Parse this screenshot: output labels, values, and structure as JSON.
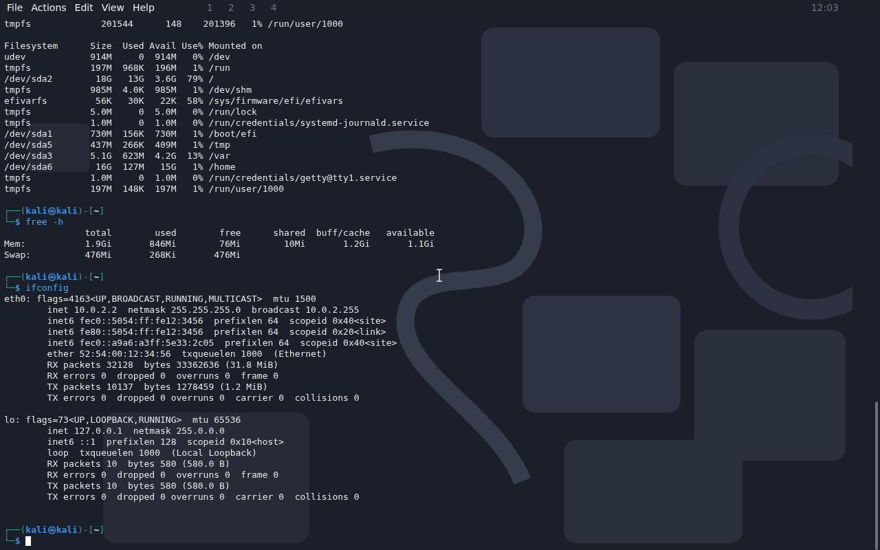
{
  "menu": [
    "File",
    "Actions",
    "Edit",
    "View",
    "Help"
  ],
  "panel": {
    "workspaces": [
      "1",
      "2",
      "3",
      "4"
    ],
    "clock": "12:03"
  },
  "lines": [
    {
      "kind": "output",
      "text": "tmpfs             201544      148    201396   1% /run/user/1000"
    },
    {
      "kind": "blank"
    },
    {
      "kind": "output",
      "text": "Filesystem      Size  Used Avail Use% Mounted on"
    },
    {
      "kind": "output",
      "text": "udev            914M     0  914M   0% /dev"
    },
    {
      "kind": "output",
      "text": "tmpfs           197M  968K  196M   1% /run"
    },
    {
      "kind": "output",
      "text": "/dev/sda2        18G   13G  3.6G  79% /"
    },
    {
      "kind": "output",
      "text": "tmpfs           985M  4.0K  985M   1% /dev/shm"
    },
    {
      "kind": "output",
      "text": "efivarfs         56K   30K   22K  58% /sys/firmware/efi/efivars"
    },
    {
      "kind": "output",
      "text": "tmpfs           5.0M     0  5.0M   0% /run/lock"
    },
    {
      "kind": "output",
      "text": "tmpfs           1.0M     0  1.0M   0% /run/credentials/systemd-journald.service"
    },
    {
      "kind": "output",
      "text": "/dev/sda1       730M  156K  730M   1% /boot/efi"
    },
    {
      "kind": "output",
      "text": "/dev/sda5       437M  266K  409M   1% /tmp"
    },
    {
      "kind": "output",
      "text": "/dev/sda3       5.1G  623M  4.2G  13% /var"
    },
    {
      "kind": "output",
      "text": "/dev/sda6        16G  127M   15G   1% /home"
    },
    {
      "kind": "output",
      "text": "tmpfs           1.0M     0  1.0M   0% /run/credentials/getty@tty1.service"
    },
    {
      "kind": "output",
      "text": "tmpfs           197M  148K  197M   1% /run/user/1000"
    },
    {
      "kind": "blank"
    },
    {
      "kind": "prompt",
      "open": "┌──(",
      "user": "kali",
      "at": "㉿",
      "host": "kali",
      "mid": ")-[",
      "dir": "~",
      "close": "]"
    },
    {
      "kind": "command",
      "lead": "└─",
      "symbol": "$",
      "text": "free -h"
    },
    {
      "kind": "output",
      "text": "               total        used        free      shared  buff/cache   available"
    },
    {
      "kind": "output",
      "text": "Mem:           1.9Gi       846Mi        76Mi        10Mi       1.2Gi       1.1Gi"
    },
    {
      "kind": "output",
      "text": "Swap:          476Mi       268Ki       476Mi"
    },
    {
      "kind": "blank"
    },
    {
      "kind": "prompt",
      "open": "┌──(",
      "user": "kali",
      "at": "㉿",
      "host": "kali",
      "mid": ")-[",
      "dir": "~",
      "close": "]"
    },
    {
      "kind": "command",
      "lead": "└─",
      "symbol": "$",
      "text": "ifconfig"
    },
    {
      "kind": "output",
      "text": "eth0: flags=4163<UP,BROADCAST,RUNNING,MULTICAST>  mtu 1500"
    },
    {
      "kind": "output",
      "text": "        inet 10.0.2.2  netmask 255.255.255.0  broadcast 10.0.2.255"
    },
    {
      "kind": "output",
      "text": "        inet6 fec0::5054:ff:fe12:3456  prefixlen 64  scopeid 0x40<site>"
    },
    {
      "kind": "output",
      "text": "        inet6 fe80::5054:ff:fe12:3456  prefixlen 64  scopeid 0x20<link>"
    },
    {
      "kind": "output",
      "text": "        inet6 fec0::a9a6:a3ff:5e33:2c05  prefixlen 64  scopeid 0x40<site>"
    },
    {
      "kind": "output",
      "text": "        ether 52:54:00:12:34:56  txqueuelen 1000  (Ethernet)"
    },
    {
      "kind": "output",
      "text": "        RX packets 32128  bytes 33362636 (31.8 MiB)"
    },
    {
      "kind": "output",
      "text": "        RX errors 0  dropped 0  overruns 0  frame 0"
    },
    {
      "kind": "output",
      "text": "        TX packets 10137  bytes 1278459 (1.2 MiB)"
    },
    {
      "kind": "output",
      "text": "        TX errors 0  dropped 0 overruns 0  carrier 0  collisions 0"
    },
    {
      "kind": "blank"
    },
    {
      "kind": "output",
      "text": "lo: flags=73<UP,LOOPBACK,RUNNING>  mtu 65536"
    },
    {
      "kind": "output",
      "text": "        inet 127.0.0.1  netmask 255.0.0.0"
    },
    {
      "kind": "output",
      "text": "        inet6 ::1  prefixlen 128  scopeid 0x10<host>"
    },
    {
      "kind": "output",
      "text": "        loop  txqueuelen 1000  (Local Loopback)"
    },
    {
      "kind": "output",
      "text": "        RX packets 10  bytes 580 (580.0 B)"
    },
    {
      "kind": "output",
      "text": "        RX errors 0  dropped 0  overruns 0  frame 0"
    },
    {
      "kind": "output",
      "text": "        TX packets 10  bytes 580 (580.0 B)"
    },
    {
      "kind": "output",
      "text": "        TX errors 0  dropped 0 overruns 0  carrier 0  collisions 0"
    },
    {
      "kind": "blank"
    },
    {
      "kind": "blank"
    },
    {
      "kind": "prompt",
      "open": "┌──(",
      "user": "kali",
      "at": "㉿",
      "host": "kali",
      "mid": ")-[",
      "dir": "~",
      "close": "]"
    },
    {
      "kind": "command",
      "lead": "└─",
      "symbol": "$",
      "cursor": true
    }
  ]
}
